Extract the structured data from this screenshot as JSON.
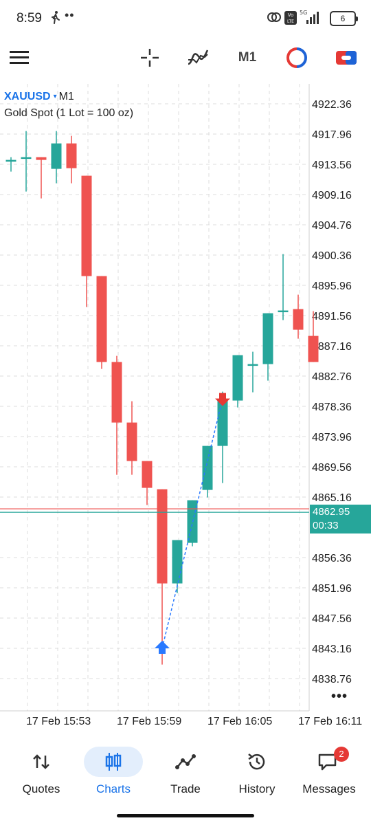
{
  "status_bar": {
    "time": "8:59",
    "dots": "••",
    "volte_label": "Vo LTE",
    "network_label": "5G",
    "battery_level": "6"
  },
  "toolbar": {
    "menu_icon": "hamburger-menu-icon",
    "crosshair_icon": "crosshair-icon",
    "indicators_icon": "indicators-icon",
    "timeframe": "M1",
    "objects_icon": "objects-icon",
    "trade_icon": "one-click-trading-icon"
  },
  "chart": {
    "symbol": "XAUUSD",
    "symbol_dropdown": "▾",
    "timeframe": "M1",
    "description": "Gold Spot (1 Lot = 100 oz)",
    "current_price": "4862.95",
    "bar_timer": "00:33",
    "more_label": "•••",
    "colors": {
      "bull": "#26a69a",
      "bear": "#ef5350",
      "grid": "#dcdcdc",
      "buy_arrow": "#2979ff",
      "sell_arrow": "#e53935"
    }
  },
  "chart_data": {
    "type": "candlestick",
    "symbol": "XAUUSD",
    "timeframe": "M1",
    "price_axis_ticks": [
      "4922.36",
      "4917.96",
      "4913.56",
      "4909.16",
      "4904.76",
      "4900.36",
      "4895.96",
      "4891.56",
      "4887.16",
      "4882.76",
      "4878.36",
      "4873.96",
      "4869.56",
      "4865.16",
      "4856.36",
      "4851.96",
      "4847.56",
      "4843.16",
      "4838.76"
    ],
    "time_axis_labels": [
      "17 Feb 15:53",
      "17 Feb 15:59",
      "17 Feb 16:05",
      "17 Feb 16:11"
    ],
    "ylim": [
      4835.8,
      4927.0
    ],
    "candles": [
      {
        "o": 4914.2,
        "h": 4914.6,
        "l": 4912.5,
        "c": 4914.2
      },
      {
        "o": 4914.6,
        "h": 4918.4,
        "l": 4909.6,
        "c": 4914.6
      },
      {
        "o": 4914.6,
        "h": 4914.6,
        "l": 4908.6,
        "c": 4914.2
      },
      {
        "o": 4912.9,
        "h": 4918.4,
        "l": 4910.8,
        "c": 4916.6
      },
      {
        "o": 4916.6,
        "h": 4917.7,
        "l": 4910.8,
        "c": 4913.0
      },
      {
        "o": 4911.9,
        "h": 4911.9,
        "l": 4892.8,
        "c": 4897.3
      },
      {
        "o": 4897.3,
        "h": 4897.3,
        "l": 4883.8,
        "c": 4884.8
      },
      {
        "o": 4884.8,
        "h": 4885.7,
        "l": 4868.4,
        "c": 4876.0
      },
      {
        "o": 4876.0,
        "h": 4879.1,
        "l": 4868.4,
        "c": 4870.4
      },
      {
        "o": 4870.4,
        "h": 4870.4,
        "l": 4864.0,
        "c": 4866.5
      },
      {
        "o": 4866.3,
        "h": 4866.3,
        "l": 4840.8,
        "c": 4852.6
      },
      {
        "o": 4852.6,
        "h": 4858.9,
        "l": 4851.2,
        "c": 4858.9
      },
      {
        "o": 4858.5,
        "h": 4864.7,
        "l": 4858.0,
        "c": 4864.7
      },
      {
        "o": 4866.2,
        "h": 4872.6,
        "l": 4865.1,
        "c": 4872.6
      },
      {
        "o": 4872.6,
        "h": 4880.5,
        "l": 4867.2,
        "c": 4879.2
      },
      {
        "o": 4879.2,
        "h": 4885.8,
        "l": 4878.2,
        "c": 4885.8
      },
      {
        "o": 4884.5,
        "h": 4886.3,
        "l": 4880.4,
        "c": 4884.5
      },
      {
        "o": 4884.5,
        "h": 4891.9,
        "l": 4882.1,
        "c": 4891.9
      },
      {
        "o": 4892.3,
        "h": 4900.5,
        "l": 4890.9,
        "c": 4892.3
      },
      {
        "o": 4892.5,
        "h": 4894.6,
        "l": 4888.2,
        "c": 4889.5
      },
      {
        "o": 4888.6,
        "h": 4892.2,
        "l": 4884.8,
        "c": 4884.8
      }
    ],
    "bid_line": 4862.95,
    "ask_line": 4863.45,
    "trades": [
      {
        "type": "buy",
        "price": 4843.16
      },
      {
        "type": "sell",
        "price": 4879.5
      }
    ]
  },
  "nav": {
    "items": [
      {
        "label": "Quotes",
        "icon": "quotes-icon"
      },
      {
        "label": "Charts",
        "icon": "charts-icon"
      },
      {
        "label": "Trade",
        "icon": "trade-icon"
      },
      {
        "label": "History",
        "icon": "history-icon"
      },
      {
        "label": "Messages",
        "icon": "messages-icon"
      }
    ],
    "messages_badge": "2"
  }
}
